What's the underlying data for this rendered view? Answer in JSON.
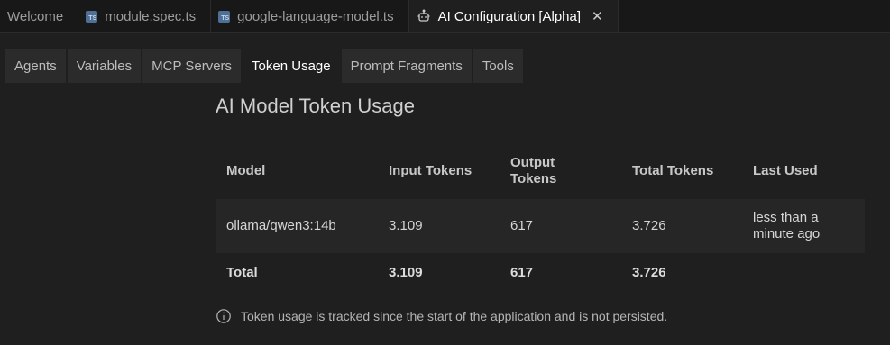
{
  "editor_tabs": [
    {
      "label": "Welcome",
      "icon": "none",
      "active": false
    },
    {
      "label": "module.spec.ts",
      "icon": "ts-file-icon",
      "active": false
    },
    {
      "label": "google-language-model.ts",
      "icon": "ts-file-icon",
      "active": false
    },
    {
      "label": "AI Configuration [Alpha]",
      "icon": "robot-icon",
      "active": true
    }
  ],
  "ts_badge": "TS",
  "config_tabs": [
    {
      "label": "Agents",
      "active": false
    },
    {
      "label": "Variables",
      "active": false
    },
    {
      "label": "MCP Servers",
      "active": false
    },
    {
      "label": "Token Usage",
      "active": true
    },
    {
      "label": "Prompt Fragments",
      "active": false
    },
    {
      "label": "Tools",
      "active": false
    }
  ],
  "page": {
    "title": "AI Model Token Usage"
  },
  "table": {
    "headers": {
      "model": "Model",
      "input": "Input Tokens",
      "output_line1": "Output",
      "output_line2": "Tokens",
      "total": "Total Tokens",
      "last_used": "Last Used"
    },
    "rows": [
      {
        "model": "ollama/qwen3:14b",
        "input": "3.109",
        "output": "617",
        "total": "3.726",
        "last_used_line1": "less than a",
        "last_used_line2": "minute ago"
      }
    ],
    "totals": {
      "label": "Total",
      "input": "3.109",
      "output": "617",
      "total": "3.726"
    }
  },
  "note": "Token usage is tracked since the start of the application and is not persisted.",
  "colors": {
    "background": "#1f1f1f",
    "tabbar": "#181818",
    "ts_icon": "#4e6f96",
    "row_bg": "#262626"
  }
}
